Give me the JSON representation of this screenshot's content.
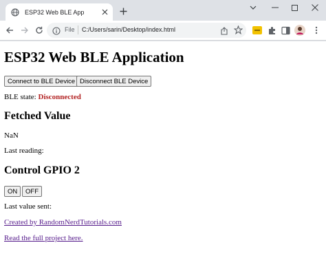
{
  "browser": {
    "tab_title": "ESP32 Web BLE App",
    "url_scheme": "File",
    "url": "C:/Users/sarin/Desktop/index.html",
    "colors": {
      "chrome_bg": "#dee1e6",
      "omnibox_bg": "#f1f3f4",
      "extension_yellow": "#f2c200"
    }
  },
  "page": {
    "title": "ESP32 Web BLE Application",
    "connect_label": "Connect to BLE Device",
    "disconnect_label": "Disconnect BLE Device",
    "ble_state_label": "BLE state:",
    "ble_state_value": "Disconnected",
    "fetched_heading": "Fetched Value",
    "fetched_value": "NaN",
    "last_reading_label": "Last reading:",
    "gpio_heading": "Control GPIO 2",
    "on_label": "ON",
    "off_label": "OFF",
    "last_sent_label": "Last value sent:",
    "credit_link": "Created by RandomNerdTutorials.com",
    "project_link": "Read the full project here.",
    "colors": {
      "state_disconnected": "#b22222",
      "link_visited": "#551a8b"
    }
  }
}
